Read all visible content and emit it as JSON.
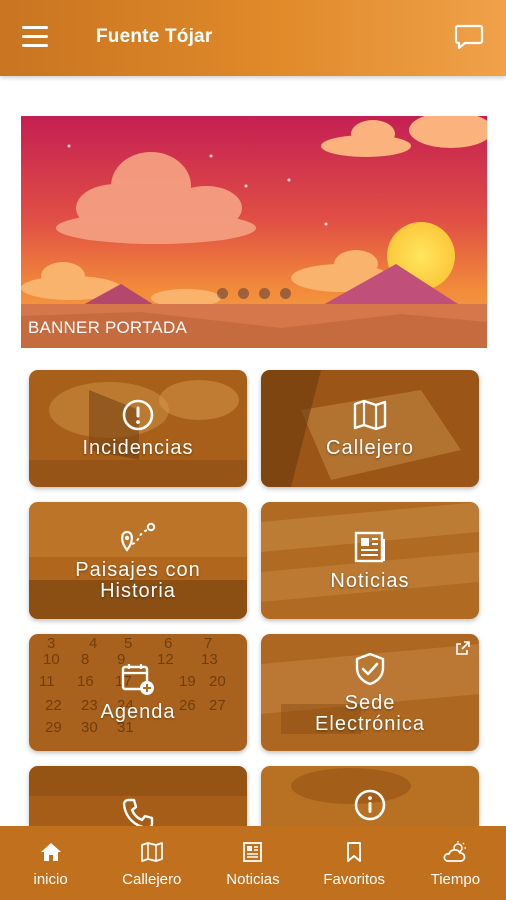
{
  "header": {
    "title": "Fuente Tójar",
    "menu_icon": "hamburger-menu-icon",
    "chat_icon": "chat-bubble-icon"
  },
  "banner": {
    "label": "BANNER PORTADA",
    "slide_count": 4,
    "active_slide": 1
  },
  "tiles": [
    {
      "label": "Incidencias",
      "icon": "alert-circle-icon"
    },
    {
      "label": "Callejero",
      "icon": "map-icon"
    },
    {
      "label": "Paisajes con\nHistoria",
      "icon": "route-pin-icon"
    },
    {
      "label": "Noticias",
      "icon": "newspaper-icon"
    },
    {
      "label": "Agenda",
      "icon": "calendar-add-icon"
    },
    {
      "label": "Sede\nElectrónica",
      "icon": "shield-check-icon",
      "external": true
    },
    {
      "label": "",
      "icon": "phone-icon"
    },
    {
      "label": "",
      "icon": "info-icon"
    }
  ],
  "bottom_nav": [
    {
      "label": "inicio",
      "icon": "home-icon"
    },
    {
      "label": "Callejero",
      "icon": "map-icon"
    },
    {
      "label": "Noticias",
      "icon": "newspaper-icon"
    },
    {
      "label": "Favoritos",
      "icon": "bookmark-icon"
    },
    {
      "label": "Tiempo",
      "icon": "weather-icon"
    }
  ],
  "colors": {
    "primary": "#e08a2a",
    "nav_bg": "#c1701e",
    "tile_tint": "#b56a1c"
  }
}
